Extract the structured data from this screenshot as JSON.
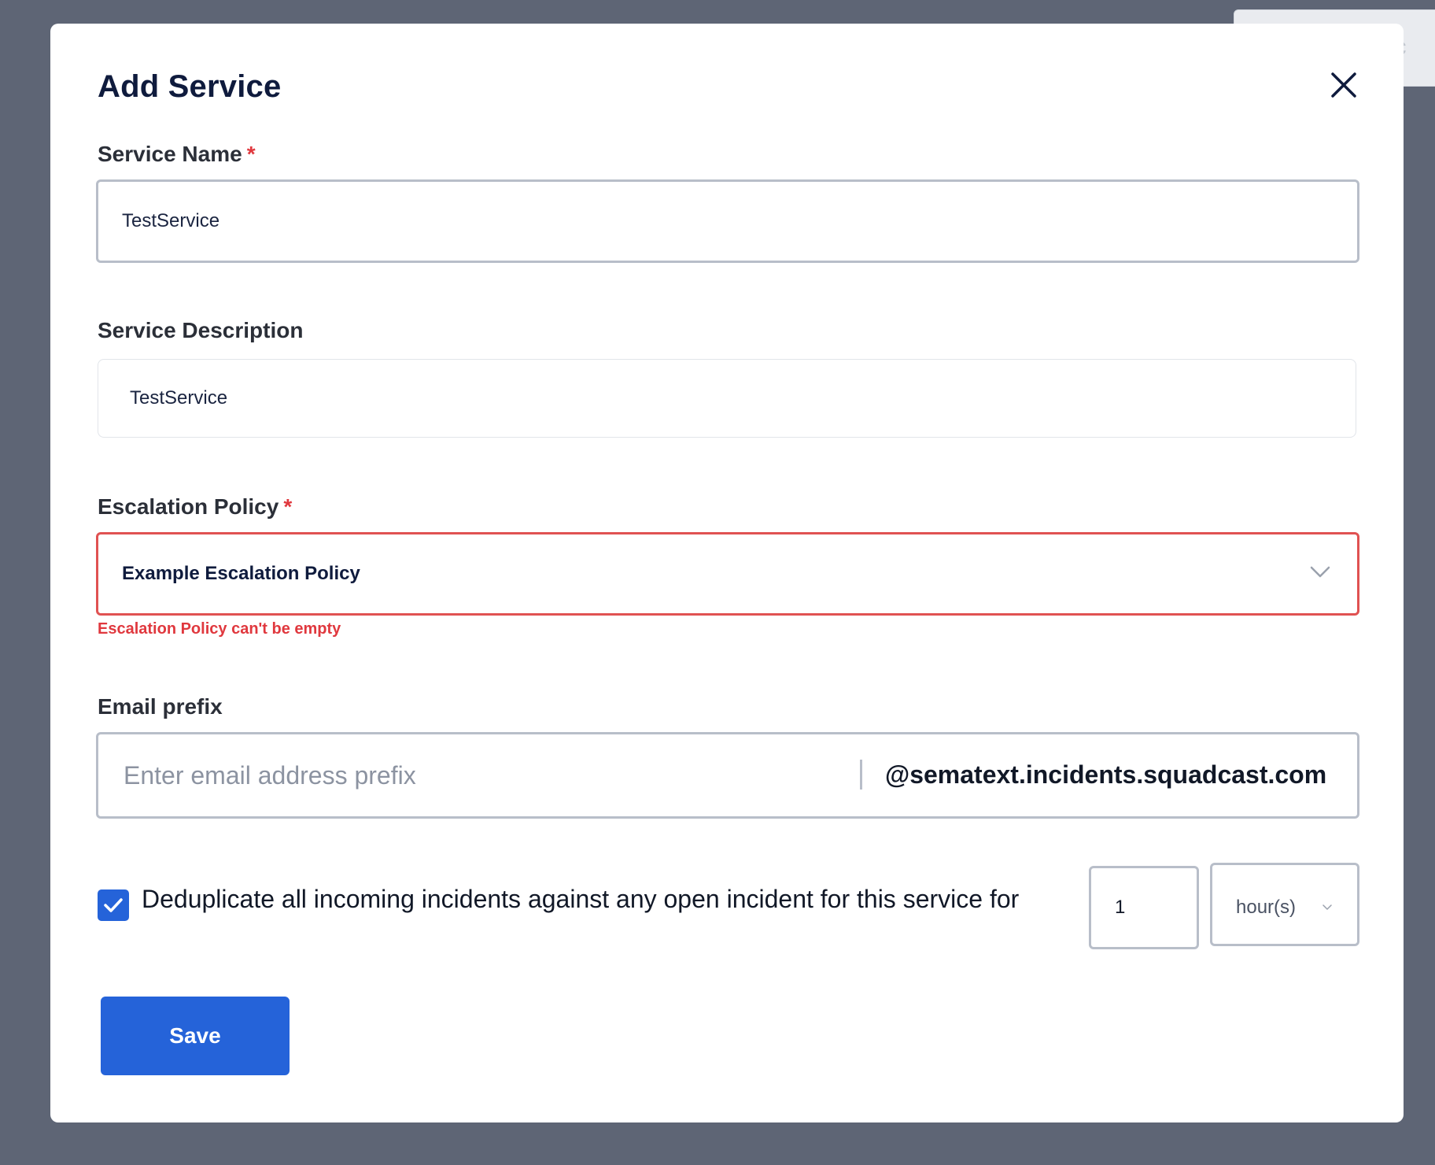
{
  "background": {
    "partial_label": "rvic"
  },
  "modal": {
    "title": "Add Service",
    "close_icon": "close-icon"
  },
  "form": {
    "service_name": {
      "label": "Service Name",
      "required_mark": "*",
      "value": "TestService"
    },
    "service_description": {
      "label": "Service Description",
      "value": "TestService"
    },
    "escalation_policy": {
      "label": "Escalation Policy",
      "required_mark": "*",
      "selected": "Example Escalation Policy",
      "error": "Escalation Policy can't be empty",
      "dropdown_icon": "chevron-down-icon"
    },
    "email_prefix": {
      "label": "Email prefix",
      "placeholder": "Enter email address prefix",
      "value": "",
      "suffix": "@sematext.incidents.squadcast.com"
    },
    "deduplicate": {
      "checked": true,
      "text": "Deduplicate all incoming incidents against any open incident for this service for",
      "duration_value": "1",
      "duration_unit": "hour(s)"
    },
    "save_label": "Save"
  },
  "colors": {
    "primary": "#2563d9",
    "error": "#e0383e",
    "overlay": "#5e6575",
    "title": "#0f1b3d"
  }
}
